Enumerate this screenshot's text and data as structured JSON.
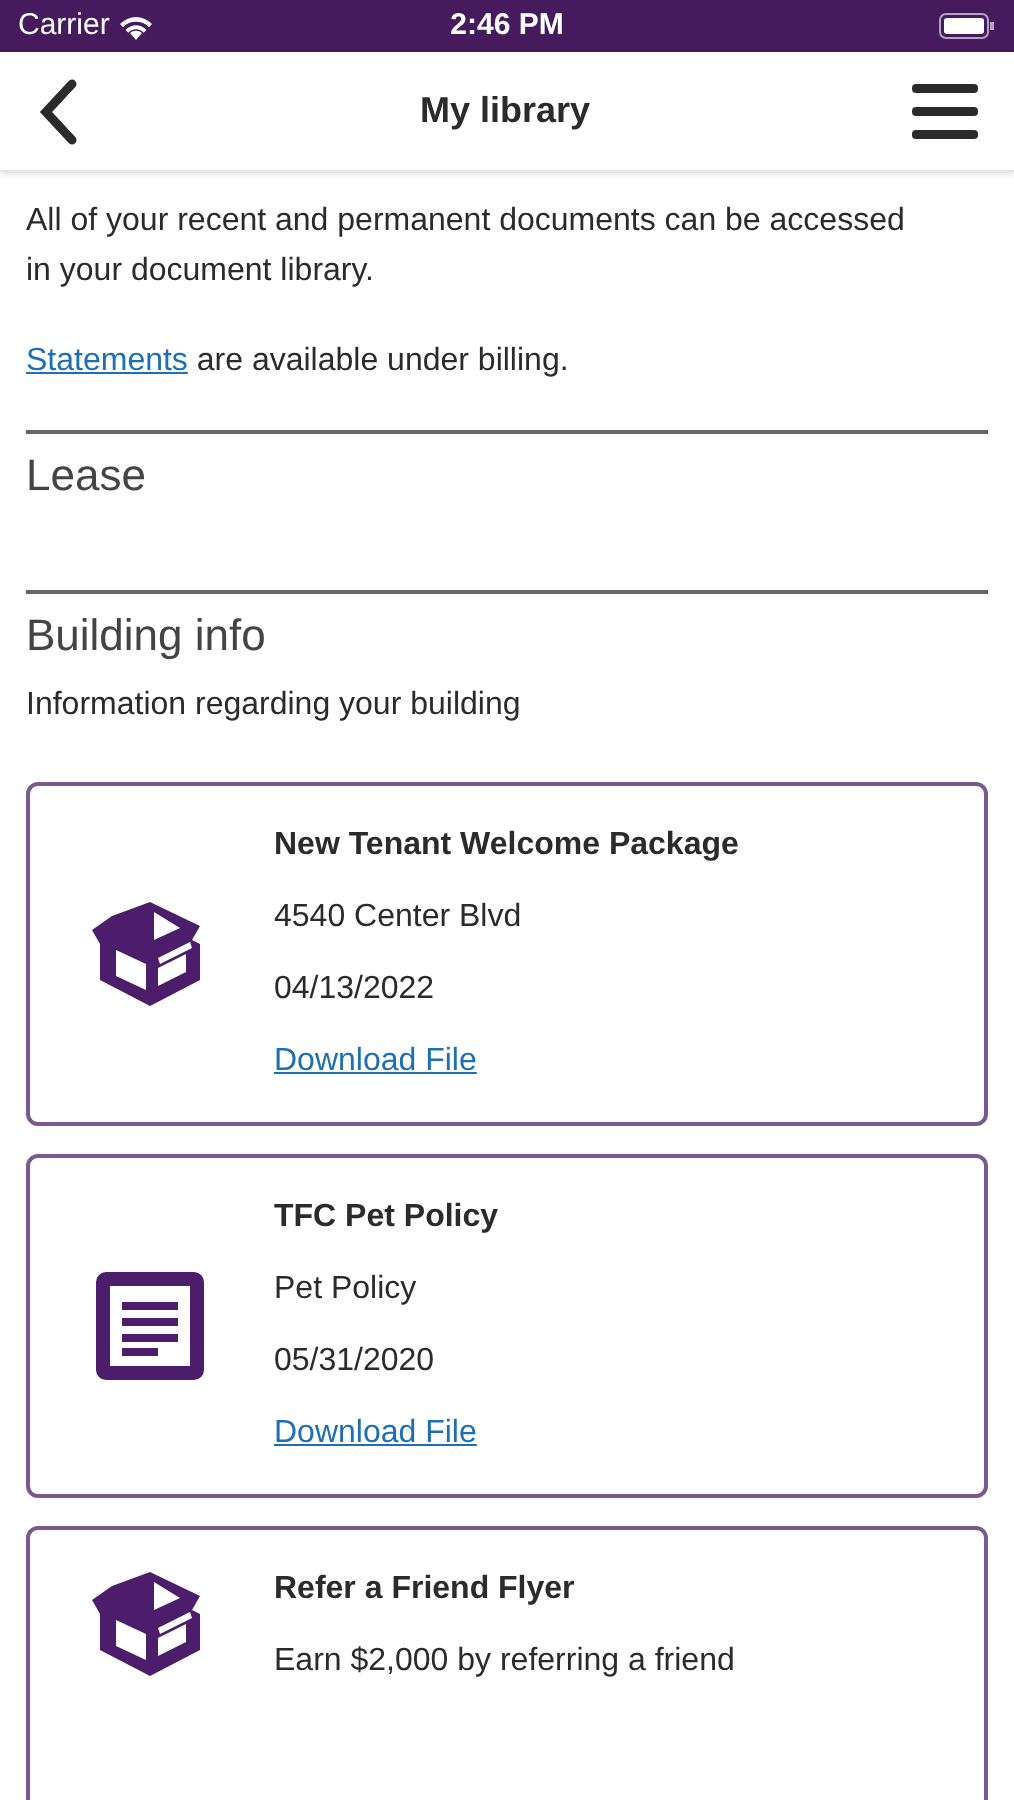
{
  "status_bar": {
    "carrier": "Carrier",
    "time": "2:46 PM"
  },
  "nav": {
    "title": "My library"
  },
  "intro": {
    "text": "All of your recent and permanent documents can be accessed in your document library.",
    "link": "Statements",
    "link_suffix": " are available under billing."
  },
  "sections": [
    {
      "title": "Lease"
    },
    {
      "title": "Building info",
      "subtitle": "Information regarding your building"
    }
  ],
  "documents": [
    {
      "kind": "package",
      "title": "New Tenant Welcome Package",
      "description": "4540 Center Blvd",
      "date": "04/13/2022",
      "link": "Download File"
    },
    {
      "kind": "document",
      "title": "TFC Pet Policy",
      "description": "Pet Policy",
      "date": "05/31/2020",
      "link": "Download File"
    },
    {
      "kind": "package",
      "title": "Refer a Friend Flyer",
      "description": "Earn $2,000 by referring a friend"
    }
  ]
}
